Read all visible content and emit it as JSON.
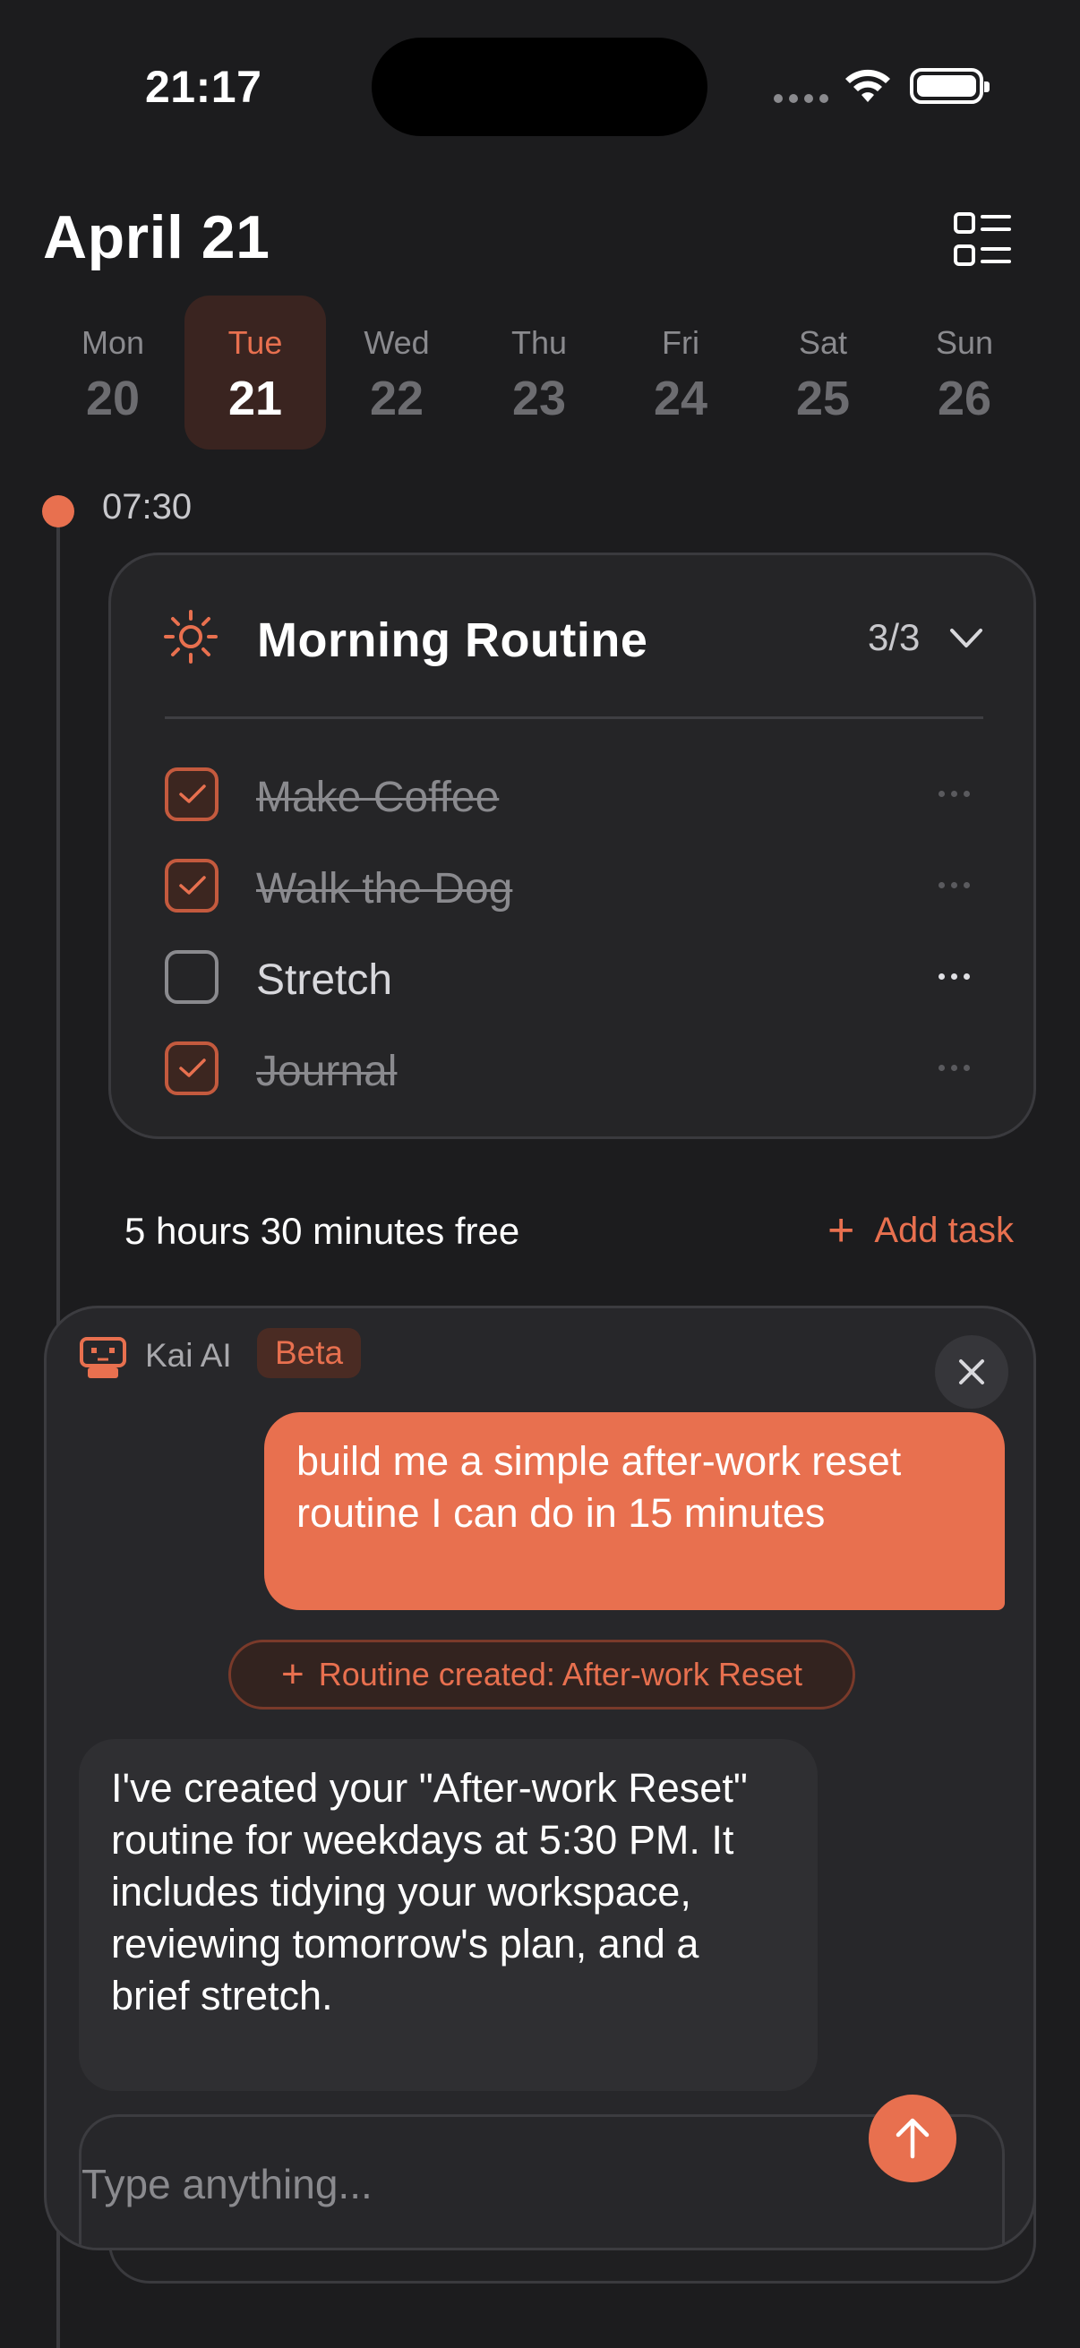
{
  "status_bar": {
    "time": "21:17"
  },
  "header": {
    "title": "April 21"
  },
  "week": [
    {
      "day": "Mon",
      "date": "20",
      "active": false
    },
    {
      "day": "Tue",
      "date": "21",
      "active": true
    },
    {
      "day": "Wed",
      "date": "22",
      "active": false
    },
    {
      "day": "Thu",
      "date": "23",
      "active": false
    },
    {
      "day": "Fri",
      "date": "24",
      "active": false
    },
    {
      "day": "Sat",
      "date": "25",
      "active": false
    },
    {
      "day": "Sun",
      "date": "26",
      "active": false
    }
  ],
  "timeline": {
    "time": "07:30"
  },
  "routine": {
    "title": "Morning Routine",
    "count": "3/3",
    "tasks": [
      {
        "label": "Make Coffee",
        "done": true
      },
      {
        "label": "Walk the Dog",
        "done": true
      },
      {
        "label": "Stretch",
        "done": false
      },
      {
        "label": "Journal",
        "done": true
      }
    ]
  },
  "free_time": "5 hours 30 minutes free",
  "add_task": "Add task",
  "chat": {
    "bot_name": "Kai AI",
    "badge": "Beta",
    "user_message": "build me a simple after-work reset routine I can do in 15 minutes",
    "chip": "Routine created: After-work Reset",
    "ai_message": "I've created your \"After-work Reset\" routine for weekdays at 5:30 PM. It includes tidying your workspace, reviewing tomorrow's plan, and a brief stretch.",
    "input_placeholder": "Type anything..."
  },
  "colors": {
    "accent": "#e8704f",
    "background": "#1c1c1e",
    "card": "#252527"
  }
}
